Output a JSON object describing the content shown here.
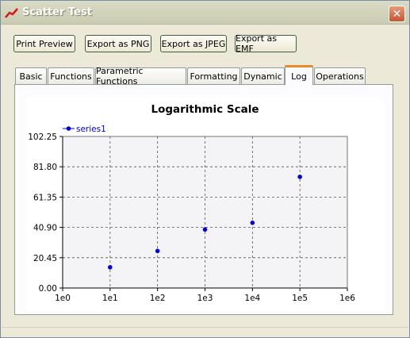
{
  "window": {
    "title": "Scatter Test",
    "close_label": "✕"
  },
  "toolbar": {
    "print_preview": "Print Preview",
    "export_png": "Export as PNG",
    "export_jpeg": "Export as JPEG",
    "export_emf": "Export as EMF"
  },
  "tabs": [
    {
      "label": "Basic"
    },
    {
      "label": "Functions"
    },
    {
      "label": "Parametric Functions"
    },
    {
      "label": "Formatting"
    },
    {
      "label": "Dynamic"
    },
    {
      "label": "Log"
    },
    {
      "label": "Operations"
    }
  ],
  "active_tab": "Log",
  "colors": {
    "series": "#0000dd",
    "active_tab_accent": "#e68b2c",
    "plot_background": "#f4f4f6"
  },
  "chart_data": {
    "type": "scatter",
    "title": "Logarithmic Scale",
    "x_scale": "log",
    "xlim": [
      1,
      1000000
    ],
    "ylim": [
      0,
      102.25
    ],
    "x_tick_labels": [
      "1e0",
      "1e1",
      "1e2",
      "1e3",
      "1e4",
      "1e5",
      "1e6"
    ],
    "x_tick_values": [
      1,
      10,
      100,
      1000,
      10000,
      100000,
      1000000
    ],
    "y_tick_labels": [
      "102.25",
      "81.80",
      "61.35",
      "40.90",
      "20.45",
      "0.00"
    ],
    "y_tick_values": [
      102.25,
      81.8,
      61.35,
      40.9,
      20.45,
      0
    ],
    "grid": true,
    "legend_position": "top-left",
    "series": [
      {
        "name": "series1",
        "points": [
          {
            "x": 10,
            "y": 14
          },
          {
            "x": 100,
            "y": 25
          },
          {
            "x": 1000,
            "y": 39.5
          },
          {
            "x": 10000,
            "y": 44
          },
          {
            "x": 100000,
            "y": 75
          }
        ]
      }
    ]
  }
}
